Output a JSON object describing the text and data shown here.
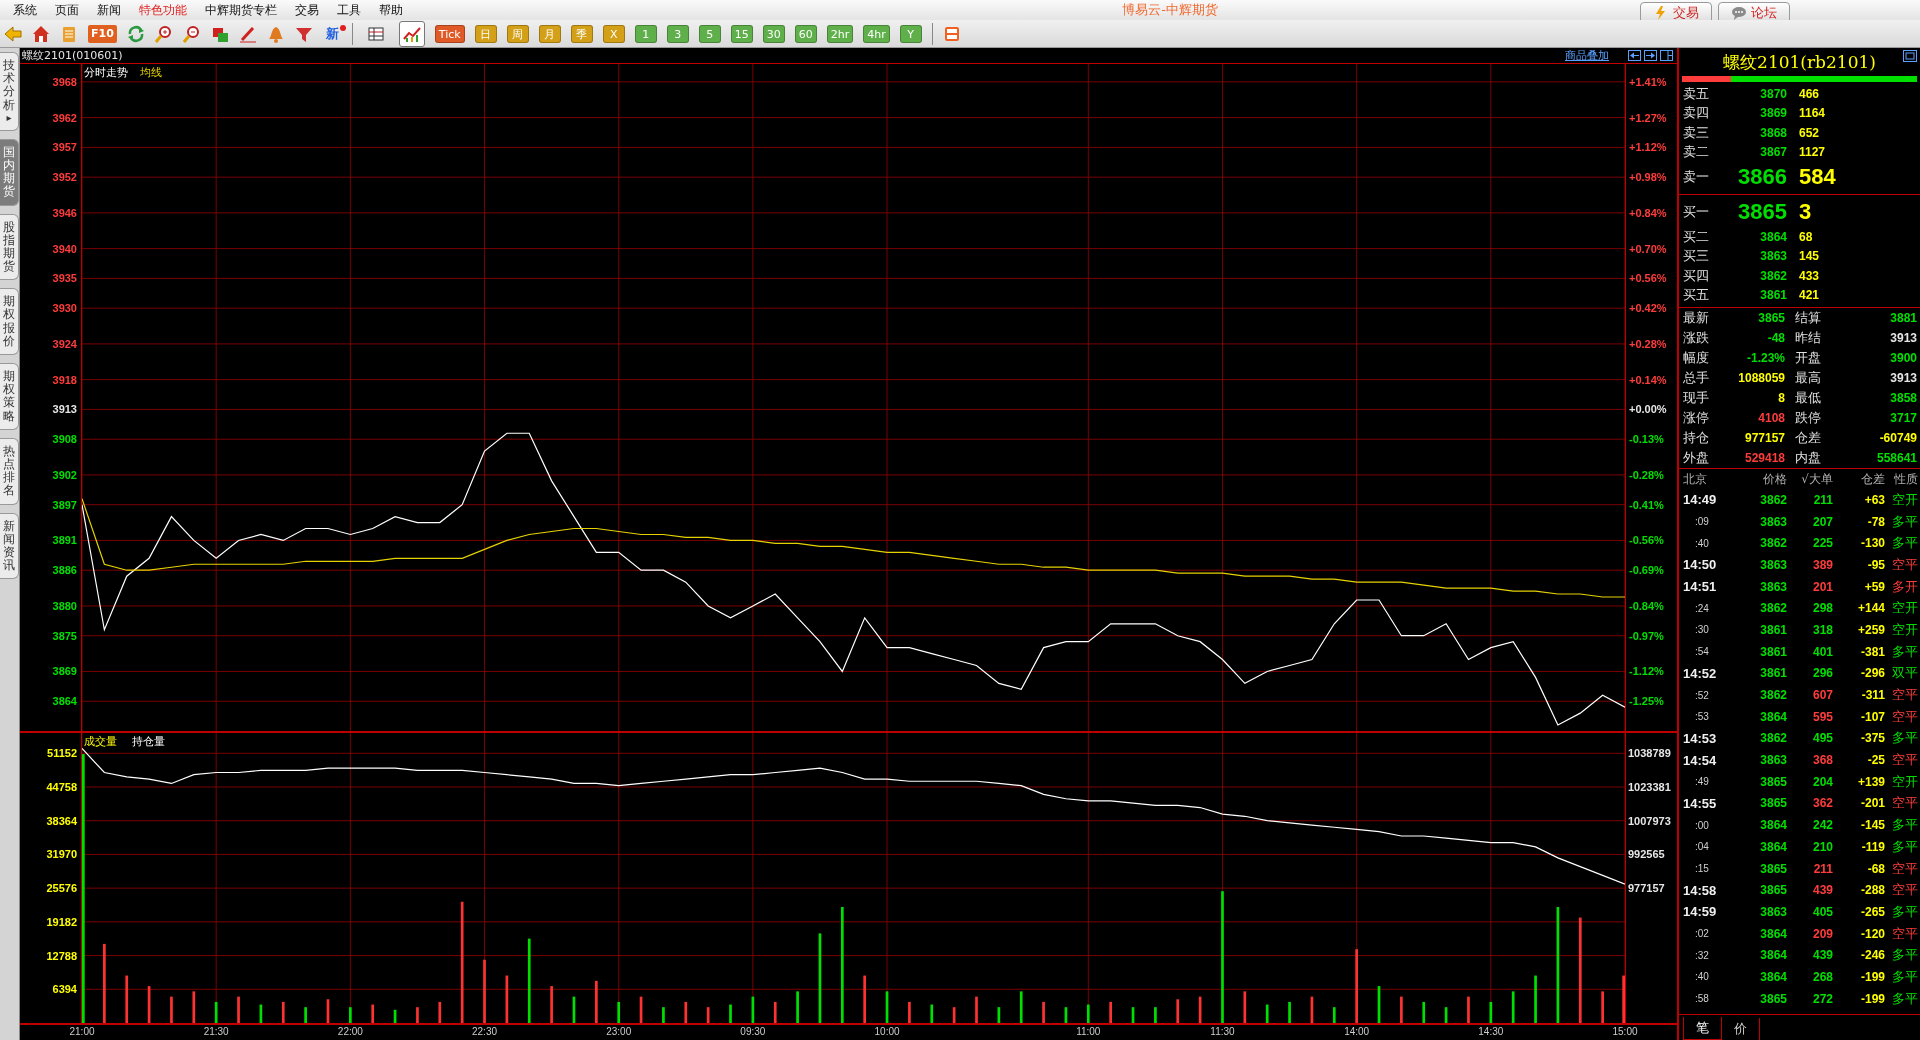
{
  "menu": [
    {
      "label": "系统",
      "highlighted": false
    },
    {
      "label": "页面",
      "highlighted": false
    },
    {
      "label": "新闻",
      "highlighted": false
    },
    {
      "label": "特色功能",
      "highlighted": true
    },
    {
      "label": "中辉期货专栏",
      "highlighted": false
    },
    {
      "label": "交易",
      "highlighted": false
    },
    {
      "label": "工具",
      "highlighted": false
    },
    {
      "label": "帮助",
      "highlighted": false
    }
  ],
  "window": {
    "title": "博易云-中辉期货"
  },
  "top_buttons": [
    {
      "label": "交易"
    },
    {
      "label": "论坛"
    }
  ],
  "toolbar": {
    "label_buttons": [
      {
        "label": "F10"
      },
      {
        "label": "新"
      }
    ],
    "view_modes": [
      {
        "selected": false
      },
      {
        "selected": true
      }
    ],
    "periods": [
      {
        "label": "Tick",
        "color": "#e05a28"
      },
      {
        "label": "日",
        "color": "#d4a017"
      },
      {
        "label": "周",
        "color": "#d4a017"
      },
      {
        "label": "月",
        "color": "#d4a017"
      },
      {
        "label": "季",
        "color": "#d4a017"
      },
      {
        "label": "X",
        "color": "#d4a017"
      },
      {
        "label": "1",
        "color": "#5fb04a"
      },
      {
        "label": "3",
        "color": "#5fb04a"
      },
      {
        "label": "5",
        "color": "#5fb04a"
      },
      {
        "label": "15",
        "color": "#5fb04a"
      },
      {
        "label": "30",
        "color": "#5fb04a"
      },
      {
        "label": "60",
        "color": "#5fb04a"
      },
      {
        "label": "2hr",
        "color": "#5fb04a"
      },
      {
        "label": "4hr",
        "color": "#5fb04a"
      },
      {
        "label": "Y",
        "color": "#5fb04a"
      }
    ]
  },
  "side_tabs": [
    {
      "label": "技术分析",
      "arrow": "▸",
      "selected": false
    },
    {
      "label": "国内期货",
      "selected": true
    },
    {
      "label": "股指期货",
      "selected": false
    },
    {
      "label": "期权报价",
      "selected": false
    },
    {
      "label": "期权策略",
      "selected": false
    },
    {
      "label": "热点排名",
      "selected": false
    },
    {
      "label": "新闻资讯",
      "selected": false
    }
  ],
  "chart_header": {
    "symbol": "螺纹2101(010601)",
    "overlay_link": "商品叠加"
  },
  "price_panel": {
    "percent_axis": [
      {
        "label": "+1.41%",
        "color": "#ff3c3c"
      },
      {
        "label": "+1.27%",
        "color": "#ff3c3c"
      },
      {
        "label": "+1.12%",
        "color": "#ff3c3c"
      },
      {
        "label": "+0.98%",
        "color": "#ff3c3c"
      },
      {
        "label": "+0.84%",
        "color": "#ff3c3c"
      },
      {
        "label": "+0.70%",
        "color": "#ff3c3c"
      },
      {
        "label": "+0.56%",
        "color": "#ff3c3c"
      },
      {
        "label": "+0.42%",
        "color": "#ff3c3c"
      },
      {
        "label": "+0.28%",
        "color": "#ff3c3c"
      },
      {
        "label": "+0.14%",
        "color": "#ff3c3c"
      },
      {
        "label": "+0.00%",
        "color": "#e6e6e6"
      },
      {
        "label": "-0.13%",
        "color": "#00e000"
      },
      {
        "label": "-0.28%",
        "color": "#00e000"
      },
      {
        "label": "-0.41%",
        "color": "#00e000"
      },
      {
        "label": "-0.56%",
        "color": "#00e000"
      },
      {
        "label": "-0.69%",
        "color": "#00e000"
      },
      {
        "label": "-0.84%",
        "color": "#00e000"
      },
      {
        "label": "-0.97%",
        "color": "#00e000"
      },
      {
        "label": "-1.12%",
        "color": "#00e000"
      },
      {
        "label": "-1.25%",
        "color": "#00e000"
      }
    ],
    "chart_data": {
      "type": "line",
      "grid": true,
      "ylim": [
        3859,
        3971
      ],
      "categories": [
        null,
        null,
        null,
        null,
        null,
        null,
        null,
        null,
        null,
        null,
        null,
        null,
        null,
        null,
        null,
        null,
        null,
        null,
        null,
        null,
        null,
        null,
        null,
        null,
        null,
        null,
        null,
        null,
        null,
        null,
        null,
        null,
        null,
        null,
        null,
        null,
        null,
        null,
        null,
        null,
        null,
        null,
        null,
        null,
        null,
        null,
        null,
        null,
        null,
        null,
        null,
        null,
        null,
        null,
        null,
        null,
        null,
        null,
        null,
        null,
        null,
        null,
        null,
        null,
        null,
        null,
        null,
        null,
        null,
        null
      ],
      "yticks": [
        3968,
        3962,
        3957,
        3952,
        3946,
        3940,
        3935,
        3930,
        3924,
        3918,
        3913,
        3908,
        3902,
        3897,
        3891,
        3886,
        3880,
        3875,
        3869,
        3864
      ],
      "series": [
        {
          "name": "分时走势",
          "color": "#ffffff",
          "values": [
            3897,
            3876,
            3885,
            3888,
            3895,
            3891,
            3888,
            3891,
            3892,
            3891,
            3893,
            3893,
            3892,
            3893,
            3895,
            3894,
            3894,
            3897,
            3906,
            3909,
            3909,
            3901,
            3895,
            3889,
            3889,
            3886,
            3886,
            3884,
            3880,
            3878,
            3880,
            3882,
            3878,
            3874,
            3869,
            3878,
            3873,
            3873,
            3872,
            3871,
            3870,
            3867,
            3866,
            3873,
            3874,
            3874,
            3877,
            3877,
            3877,
            3875,
            3874,
            3871,
            3867,
            3869,
            3870,
            3871,
            3877,
            3881,
            3881,
            3875,
            3875,
            3877,
            3871,
            3873,
            3874,
            3868,
            3860,
            3862,
            3865,
            3863
          ]
        },
        {
          "name": "均线",
          "color": "#e6d200",
          "values": [
            3898,
            3887,
            3886,
            3886,
            3886.5,
            3887,
            3887,
            3887,
            3887,
            3887,
            3887.5,
            3887.5,
            3887.5,
            3887.5,
            3888,
            3888,
            3888,
            3888,
            3889.5,
            3891,
            3892,
            3892.5,
            3893,
            3893,
            3892.5,
            3892,
            3892,
            3891.5,
            3891.5,
            3891,
            3891,
            3890.5,
            3890.5,
            3890,
            3890,
            3889.5,
            3889,
            3889,
            3888.5,
            3888,
            3887.5,
            3887,
            3887,
            3886.5,
            3886.5,
            3886,
            3886,
            3886,
            3886,
            3885.5,
            3885.5,
            3885.5,
            3885,
            3885,
            3885,
            3884.5,
            3884.5,
            3884,
            3884,
            3884,
            3883.5,
            3883,
            3883,
            3883,
            3882.5,
            3882.5,
            3882,
            3882,
            3881.5,
            3881.5
          ]
        }
      ]
    }
  },
  "volume_panel": {
    "legend": "成交量",
    "chart_data": {
      "type": "bar",
      "stacked": true,
      "grid": true,
      "ylim": [
        0,
        55000
      ],
      "categories": [
        "21:00",
        null,
        null,
        null,
        null,
        null,
        "21:30",
        null,
        null,
        null,
        null,
        null,
        "22:00",
        null,
        null,
        null,
        null,
        null,
        "22:30",
        null,
        null,
        null,
        null,
        null,
        "23:00",
        null,
        null,
        null,
        null,
        null,
        "09:30",
        null,
        null,
        null,
        null,
        null,
        "10:00",
        null,
        null,
        null,
        null,
        null,
        null,
        null,
        null,
        "11:00",
        null,
        null,
        null,
        null,
        null,
        "11:30",
        null,
        null,
        null,
        null,
        null,
        "14:00",
        null,
        null,
        null,
        null,
        null,
        "14:30",
        null,
        null,
        null,
        null,
        null,
        "15:00"
      ],
      "yticks": [
        6394,
        12788,
        19182,
        25576,
        31970,
        38364,
        44758,
        51152
      ],
      "series": [
        {
          "color": "#ff3232",
          "values": [
            null,
            15000,
            9000,
            7000,
            5000,
            6000,
            null,
            5000,
            null,
            4000,
            null,
            4500,
            null,
            3500,
            null,
            3000,
            4000,
            23000,
            12000,
            9000,
            null,
            7000,
            null,
            8000,
            null,
            5000,
            null,
            4000,
            3000,
            null,
            null,
            4000,
            null,
            null,
            null,
            9000,
            null,
            4000,
            null,
            3000,
            5000,
            null,
            null,
            4000,
            null,
            null,
            4000,
            null,
            null,
            4500,
            5000,
            null,
            6000,
            null,
            null,
            5000,
            null,
            14000,
            null,
            5000,
            null,
            null,
            5000,
            null,
            null,
            null,
            null,
            20000,
            6000,
            9000
          ]
        },
        {
          "color": "#00e000",
          "values": [
            51000,
            null,
            null,
            null,
            null,
            null,
            4000,
            null,
            3500,
            null,
            3000,
            null,
            3000,
            null,
            2500,
            null,
            null,
            null,
            null,
            null,
            16000,
            null,
            5000,
            null,
            4000,
            null,
            3000,
            null,
            null,
            3500,
            5000,
            null,
            6000,
            17000,
            22000,
            null,
            6000,
            null,
            3500,
            null,
            null,
            3000,
            6000,
            null,
            3000,
            3500,
            null,
            3000,
            3000,
            null,
            null,
            25000,
            null,
            3500,
            4000,
            null,
            3000,
            null,
            7000,
            null,
            4000,
            3000,
            null,
            4000,
            6000,
            9000,
            22000,
            null,
            null,
            null
          ]
        }
      ]
    },
    "open_interest": {
      "chart_data": {
        "type": "line",
        "ylim": [
          915525,
          1048062
        ],
        "yticks": [
          977157,
          992565,
          1007973,
          1023381,
          1038789
        ],
        "categories": [
          null,
          null,
          null,
          null,
          null,
          null,
          null,
          null,
          null,
          null,
          null,
          null,
          null,
          null,
          null,
          null,
          null,
          null,
          null,
          null,
          null,
          null,
          null,
          null,
          null,
          null,
          null,
          null,
          null,
          null,
          null,
          null,
          null,
          null,
          null,
          null,
          null,
          null,
          null,
          null,
          null,
          null,
          null,
          null,
          null,
          null,
          null,
          null,
          null,
          null,
          null,
          null,
          null,
          null,
          null,
          null,
          null,
          null,
          null,
          null,
          null,
          null,
          null,
          null,
          null,
          null,
          null,
          null,
          null,
          null
        ],
        "series": [
          {
            "name": "持仓量",
            "color": "#ffffff",
            "values": [
              1041000,
              1030000,
              1028000,
              1027000,
              1025000,
              1029000,
              1030000,
              1030000,
              1031000,
              1031000,
              1031000,
              1032000,
              1032000,
              1032000,
              1032000,
              1031000,
              1031000,
              1031000,
              1030000,
              1029000,
              1028000,
              1027000,
              1025000,
              1025000,
              1024000,
              1025000,
              1026000,
              1027000,
              1028000,
              1029000,
              1029000,
              1030000,
              1031000,
              1032000,
              1030000,
              1027000,
              1027000,
              1026000,
              1026000,
              1026000,
              1026000,
              1025000,
              1024000,
              1020000,
              1018000,
              1017000,
              1017000,
              1016000,
              1015000,
              1015000,
              1014000,
              1011000,
              1010000,
              1008000,
              1007000,
              1006000,
              1005000,
              1004000,
              1003000,
              1001000,
              1001000,
              1000000,
              999000,
              998000,
              998000,
              996000,
              991000,
              987000,
              983000,
              979000
            ]
          }
        ]
      }
    }
  },
  "quote": {
    "title": "螺纹2101(rb2101)",
    "ratio_bar": {
      "level": 0.21
    },
    "asks": [
      {
        "label": "卖五",
        "price": "3870",
        "volume": "466",
        "kind": "level"
      },
      {
        "label": "卖四",
        "price": "3869",
        "volume": "1164",
        "kind": "level"
      },
      {
        "label": "卖三",
        "price": "3868",
        "volume": "652",
        "kind": "level"
      },
      {
        "label": "卖二",
        "price": "3867",
        "volume": "1127",
        "kind": "level"
      },
      {
        "label": "卖一",
        "price": "3866",
        "volume": "584",
        "kind": "best"
      }
    ],
    "bids": [
      {
        "label": "买一",
        "price": "3865",
        "volume": "3",
        "kind": "best"
      },
      {
        "label": "买二",
        "price": "3864",
        "volume": "68",
        "kind": "level"
      },
      {
        "label": "买三",
        "price": "3863",
        "volume": "145",
        "kind": "level"
      },
      {
        "label": "买四",
        "price": "3862",
        "volume": "433",
        "kind": "level"
      },
      {
        "label": "买五",
        "price": "3861",
        "volume": "421",
        "kind": "level"
      }
    ],
    "stats": [
      {
        "label": "最新",
        "value": "3865",
        "color": "#00e000"
      },
      {
        "label": "结算",
        "value": "3881",
        "color": "#00e000"
      },
      {
        "label": "涨跌",
        "value": "-48",
        "color": "#00e000"
      },
      {
        "label": "昨结",
        "value": "3913",
        "color": "#e6e6e6"
      },
      {
        "label": "幅度",
        "value": "-1.23%",
        "color": "#00e000"
      },
      {
        "label": "开盘",
        "value": "3900",
        "color": "#00e000"
      },
      {
        "label": "总手",
        "value": "1088059",
        "color": "#ffff00"
      },
      {
        "label": "最高",
        "value": "3913",
        "color": "#e6e6e6"
      },
      {
        "label": "现手",
        "value": "8",
        "color": "#ffff00"
      },
      {
        "label": "最低",
        "value": "3858",
        "color": "#00e000"
      },
      {
        "label": "涨停",
        "value": "4108",
        "color": "#ff3c3c"
      },
      {
        "label": "跌停",
        "value": "3717",
        "color": "#00e000"
      },
      {
        "label": "持仓",
        "value": "977157",
        "color": "#ffff00"
      },
      {
        "label": "仓差",
        "value": "-60749",
        "color": "#ffff00"
      },
      {
        "label": "外盘",
        "value": "529418",
        "color": "#ff3c3c"
      },
      {
        "label": "内盘",
        "value": "558641",
        "color": "#00e000"
      }
    ],
    "ticks": {
      "columns": [
        "北京",
        "价格",
        "√大单",
        "仓差",
        "性质"
      ],
      "rows": [
        {
          "time": "14:49",
          "kind": "minute",
          "price": "3862",
          "volume": "211",
          "change": "+63",
          "nature": "空开",
          "color": "#00e000"
        },
        {
          "time": ":09",
          "kind": "second",
          "price": "3863",
          "volume": "207",
          "change": "-78",
          "nature": "多平",
          "color": "#00e000"
        },
        {
          "time": ":40",
          "kind": "second",
          "price": "3862",
          "volume": "225",
          "change": "-130",
          "nature": "多平",
          "color": "#00e000"
        },
        {
          "time": "14:50",
          "kind": "minute",
          "price": "3863",
          "volume": "389",
          "change": "-95",
          "nature": "空平",
          "color": "#ff3c3c"
        },
        {
          "time": "14:51",
          "kind": "minute",
          "price": "3863",
          "volume": "201",
          "change": "+59",
          "nature": "多开",
          "color": "#ff3c3c"
        },
        {
          "time": ":24",
          "kind": "second",
          "price": "3862",
          "volume": "298",
          "change": "+144",
          "nature": "空开",
          "color": "#00e000"
        },
        {
          "time": ":30",
          "kind": "second",
          "price": "3861",
          "volume": "318",
          "change": "+259",
          "nature": "空开",
          "color": "#00e000"
        },
        {
          "time": ":54",
          "kind": "second",
          "price": "3861",
          "volume": "401",
          "change": "-381",
          "nature": "多平",
          "color": "#00e000"
        },
        {
          "time": "14:52",
          "kind": "minute",
          "price": "3861",
          "volume": "296",
          "change": "-296",
          "nature": "双平",
          "color": "#00e000"
        },
        {
          "time": ":52",
          "kind": "second",
          "price": "3862",
          "volume": "607",
          "change": "-311",
          "nature": "空平",
          "color": "#ff3c3c"
        },
        {
          "time": ":53",
          "kind": "second",
          "price": "3864",
          "volume": "595",
          "change": "-107",
          "nature": "空平",
          "color": "#ff3c3c"
        },
        {
          "time": "14:53",
          "kind": "minute",
          "price": "3862",
          "volume": "495",
          "change": "-375",
          "nature": "多平",
          "color": "#00e000"
        },
        {
          "time": "14:54",
          "kind": "minute",
          "price": "3863",
          "volume": "368",
          "change": "-25",
          "nature": "空平",
          "color": "#ff3c3c"
        },
        {
          "time": ":49",
          "kind": "second",
          "price": "3865",
          "volume": "204",
          "change": "+139",
          "nature": "空开",
          "color": "#00e000"
        },
        {
          "time": "14:55",
          "kind": "minute",
          "price": "3865",
          "volume": "362",
          "change": "-201",
          "nature": "空平",
          "color": "#ff3c3c"
        },
        {
          "time": ":00",
          "kind": "second",
          "price": "3864",
          "volume": "242",
          "change": "-145",
          "nature": "多平",
          "color": "#00e000"
        },
        {
          "time": ":04",
          "kind": "second",
          "price": "3864",
          "volume": "210",
          "change": "-119",
          "nature": "多平",
          "color": "#00e000"
        },
        {
          "time": ":15",
          "kind": "second",
          "price": "3865",
          "volume": "211",
          "change": "-68",
          "nature": "空平",
          "color": "#ff3c3c"
        },
        {
          "time": "14:58",
          "kind": "minute",
          "price": "3865",
          "volume": "439",
          "change": "-288",
          "nature": "空平",
          "color": "#ff3c3c"
        },
        {
          "time": "14:59",
          "kind": "minute",
          "price": "3863",
          "volume": "405",
          "change": "-265",
          "nature": "多平",
          "color": "#00e000"
        },
        {
          "time": ":02",
          "kind": "second",
          "price": "3864",
          "volume": "209",
          "change": "-120",
          "nature": "空平",
          "color": "#ff3c3c"
        },
        {
          "time": ":32",
          "kind": "second",
          "price": "3864",
          "volume": "439",
          "change": "-246",
          "nature": "多平",
          "color": "#00e000"
        },
        {
          "time": ":40",
          "kind": "second",
          "price": "3864",
          "volume": "268",
          "change": "-199",
          "nature": "多平",
          "color": "#00e000"
        },
        {
          "time": ":58",
          "kind": "second",
          "price": "3865",
          "volume": "272",
          "change": "-199",
          "nature": "多平",
          "color": "#00e000"
        }
      ]
    },
    "tabs": [
      {
        "label": "笔",
        "selected": true
      },
      {
        "label": "价",
        "selected": false
      }
    ]
  }
}
